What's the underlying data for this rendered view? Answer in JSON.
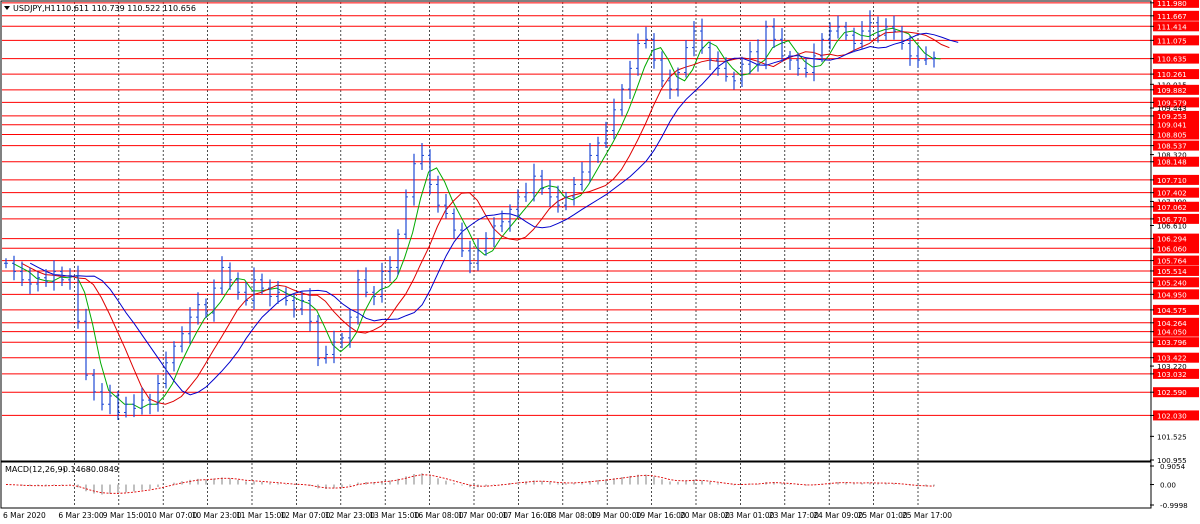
{
  "header": {
    "symbol_label": "USDJPY,H1",
    "ohlc_label": "110.611 110.739 110.522 110.656"
  },
  "macd": {
    "label": "MACD(12,26,9)",
    "main_value": "-0.1468",
    "signal_value": "-0.0849",
    "scale_labels": [
      "0.9054",
      "0.00",
      "-0.9998"
    ]
  },
  "chart_data": {
    "type": "line",
    "title": "",
    "symbol": "USDJPY",
    "timeframe": "H1",
    "ylim": [
      100.955,
      112.0
    ],
    "grid": true,
    "price_scale_labels": [
      "111.980",
      "111.667",
      "111.414",
      "111.075",
      "110.635",
      "110.261",
      "110.015",
      "109.882",
      "109.579",
      "109.443",
      "109.253",
      "109.041",
      "108.805",
      "108.537",
      "108.320",
      "108.148",
      "107.710",
      "107.402",
      "107.190",
      "107.062",
      "106.770",
      "106.610",
      "106.294",
      "106.060",
      "105.764",
      "105.514",
      "105.240",
      "104.950",
      "104.575",
      "104.264",
      "104.050",
      "103.796",
      "103.422",
      "103.220",
      "103.032",
      "102.590",
      "102.030",
      "101.525",
      "100.955"
    ],
    "horizontal_levels": [
      111.98,
      111.667,
      111.414,
      111.075,
      110.635,
      110.261,
      109.882,
      109.579,
      109.253,
      109.041,
      108.805,
      108.537,
      108.148,
      107.71,
      107.402,
      107.062,
      106.77,
      106.294,
      106.06,
      105.764,
      105.514,
      105.24,
      104.95,
      104.575,
      104.264,
      104.05,
      103.796,
      103.422,
      103.032,
      102.59,
      102.03
    ],
    "x_tick_labels": [
      "6 Mar 2020",
      "6 Mar 23:00",
      "9 Mar 15:00",
      "10 Mar 07:00",
      "10 Mar 23:00",
      "11 Mar 15:00",
      "12 Mar 07:00",
      "12 Mar 23:00",
      "13 Mar 15:00",
      "16 Mar 08:00",
      "17 Mar 00:00",
      "17 Mar 16:00",
      "18 Mar 08:00",
      "19 Mar 00:00",
      "19 Mar 16:00",
      "20 Mar 08:00",
      "23 Mar 01:00",
      "23 Mar 17:00",
      "24 Mar 09:00",
      "25 Mar 01:00",
      "25 Mar 17:00"
    ],
    "price_series": [
      105.7,
      105.5,
      105.3,
      105.2,
      105.35,
      105.25,
      105.5,
      105.3,
      105.4,
      104.3,
      103.0,
      102.6,
      102.3,
      102.5,
      102.1,
      102.3,
      102.2,
      102.4,
      102.3,
      102.8,
      103.3,
      103.7,
      104.0,
      104.4,
      104.7,
      104.5,
      105.1,
      105.6,
      105.3,
      105.0,
      104.8,
      105.3,
      105.1,
      104.9,
      105.0,
      104.8,
      104.6,
      104.8,
      104.3,
      103.4,
      103.5,
      103.8,
      103.9,
      104.4,
      105.3,
      105.0,
      104.9,
      105.5,
      105.6,
      106.4,
      107.3,
      108.1,
      108.3,
      107.6,
      107.1,
      106.9,
      106.5,
      106.0,
      105.7,
      106.0,
      106.3,
      106.6,
      106.7,
      107.0,
      107.3,
      107.4,
      107.8,
      107.5,
      107.3,
      107.1,
      107.3,
      107.6,
      107.9,
      108.3,
      108.6,
      108.9,
      109.4,
      109.9,
      110.4,
      111.0,
      111.1,
      110.6,
      110.1,
      109.9,
      110.3,
      110.9,
      111.3,
      110.9,
      110.6,
      110.4,
      110.2,
      110.1,
      110.5,
      110.8,
      110.5,
      111.4,
      111.1,
      110.7,
      110.6,
      110.4,
      110.3,
      110.7,
      111.1,
      111.3,
      111.4,
      111.2,
      111.0,
      111.3,
      111.5,
      111.2,
      111.4,
      111.3,
      111.0,
      110.7,
      110.6,
      110.63,
      110.656
    ],
    "ma_series": [
      {
        "color": "#00aa00",
        "period": 8
      },
      {
        "color": "#dd0000",
        "period": 21
      },
      {
        "color": "#0000cc",
        "period": 34
      }
    ],
    "macd_series": {
      "histogram_color": "#c0c0c0",
      "signal_color": "#dd0000",
      "main_value": -0.1468,
      "signal_value": -0.0849,
      "ylim": [
        -0.9998,
        0.9054
      ]
    }
  },
  "colors": {
    "candle": "#1f49d6",
    "level_line": "#ff0000",
    "level_label_bg": "#ff0000",
    "grid": "#000000"
  }
}
